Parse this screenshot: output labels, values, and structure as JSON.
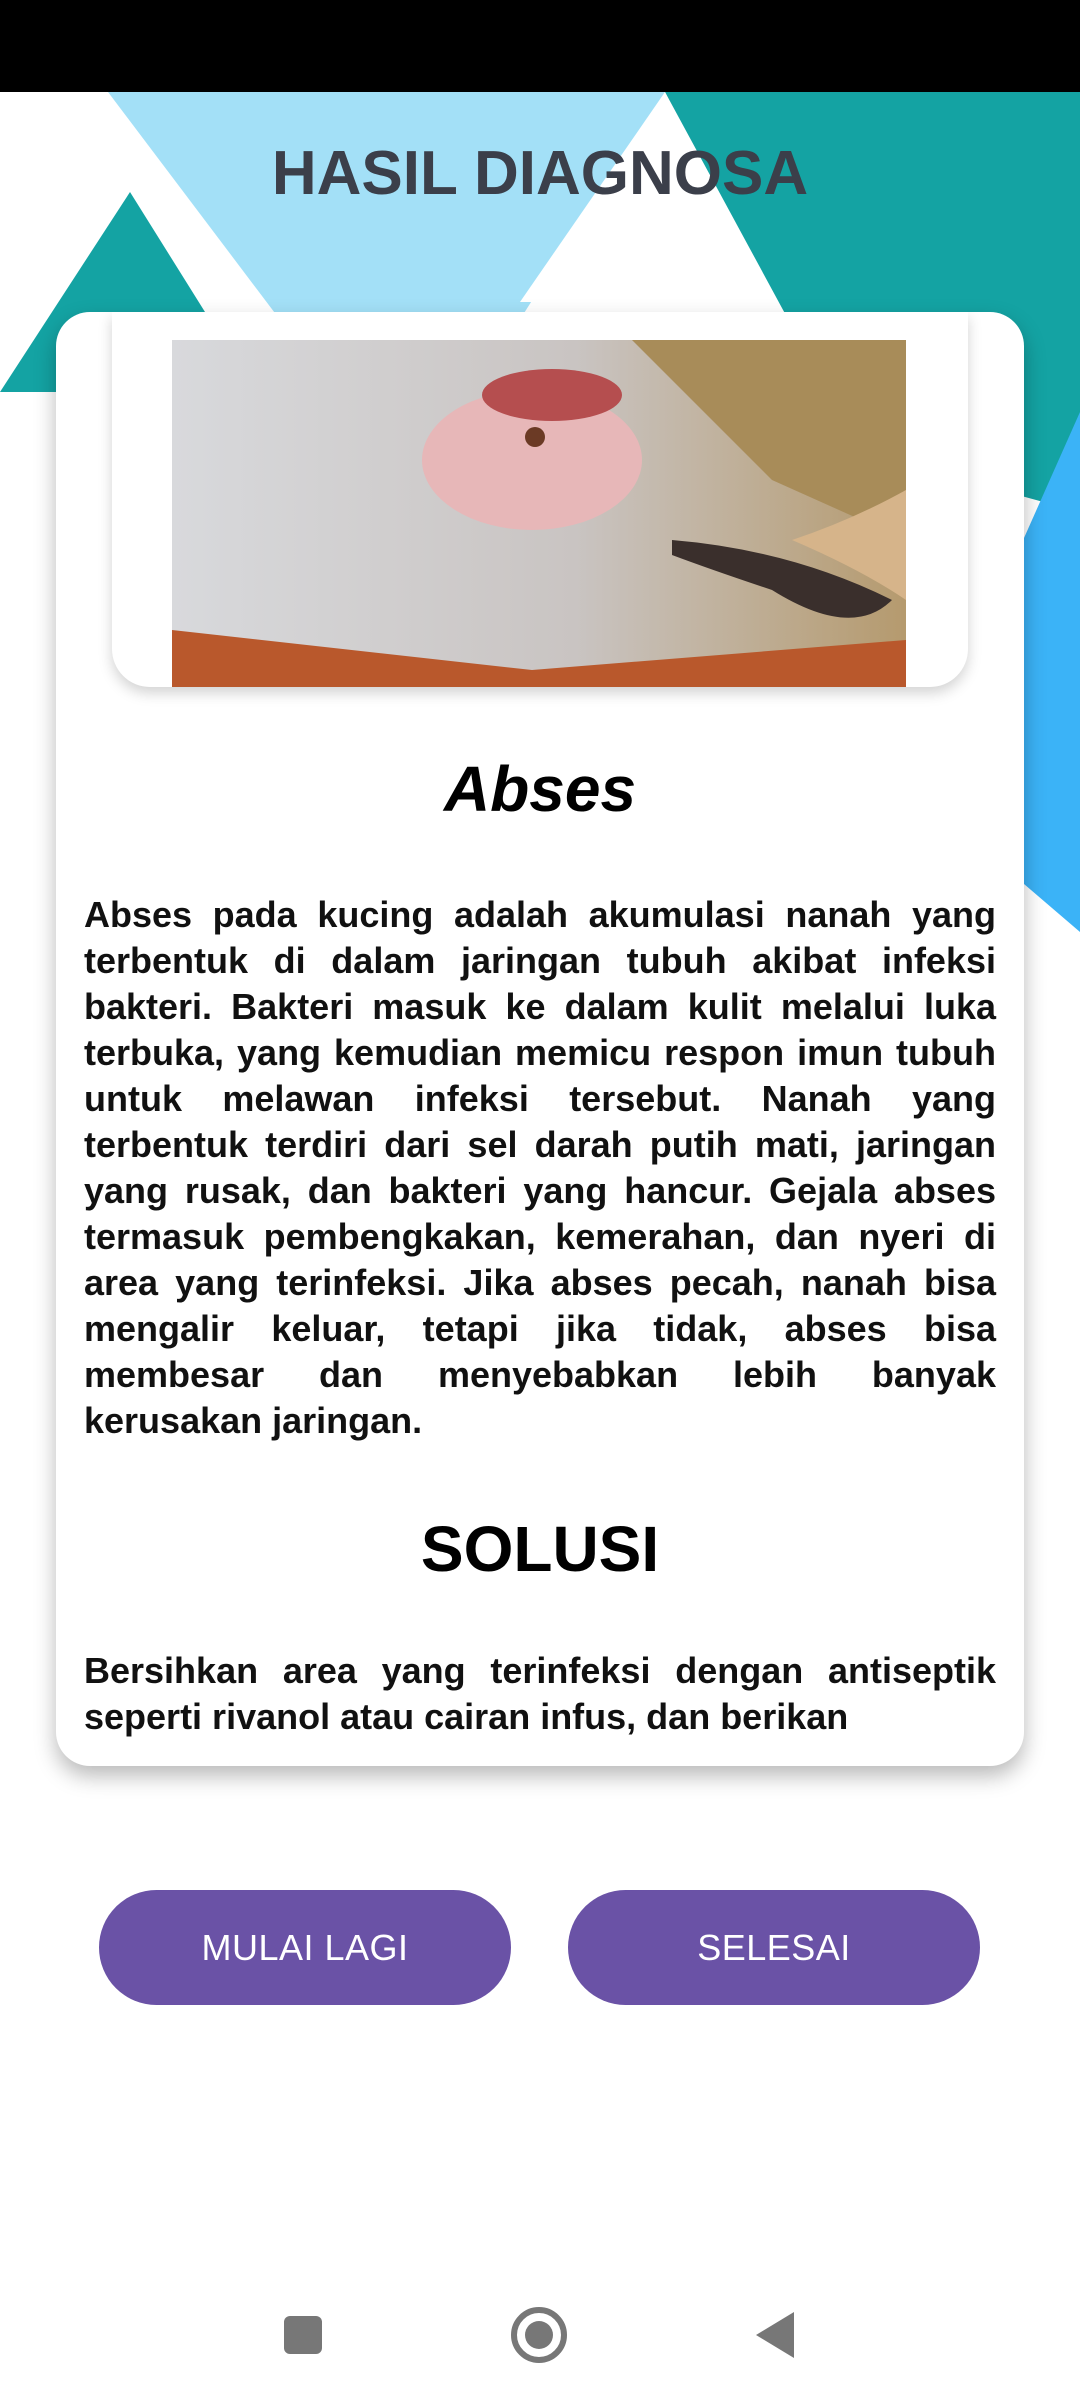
{
  "header": {
    "title": "HASIL DIAGNOSA"
  },
  "result": {
    "image_icon": "cat-abscess-photo",
    "disease_name": "Abses",
    "description": "Abses pada kucing adalah akumulasi nanah yang terbentuk di dalam jaringan tubuh akibat infeksi bakteri. Bakteri masuk ke dalam kulit melalui luka terbuka, yang kemudian memicu respon imun tubuh untuk melawan infeksi tersebut. Nanah yang terbentuk terdiri dari sel darah putih mati, jaringan yang rusak, dan bakteri yang hancur. Gejala abses termasuk pembengkakan, kemerahan, dan nyeri di area yang terinfeksi. Jika abses pecah, nanah bisa mengalir keluar, tetapi jika tidak, abses bisa membesar dan menyebabkan lebih banyak kerusakan jaringan.",
    "solution_title": "SOLUSI",
    "solution_text": "Bersihkan area yang terinfeksi dengan antiseptik seperti rivanol atau cairan infus, dan berikan"
  },
  "buttons": {
    "restart": "MULAI LAGI",
    "finish": "SELESAI"
  },
  "navbar": {
    "icons": [
      "recents-square-icon",
      "home-circle-icon",
      "back-triangle-icon"
    ]
  },
  "colors": {
    "accent_teal": "#14a3a3",
    "light_blue": "#a3e0f7",
    "bright_blue": "#3bb3f7",
    "button_purple": "#6a52a6",
    "title_gray": "#3b3f4a"
  }
}
